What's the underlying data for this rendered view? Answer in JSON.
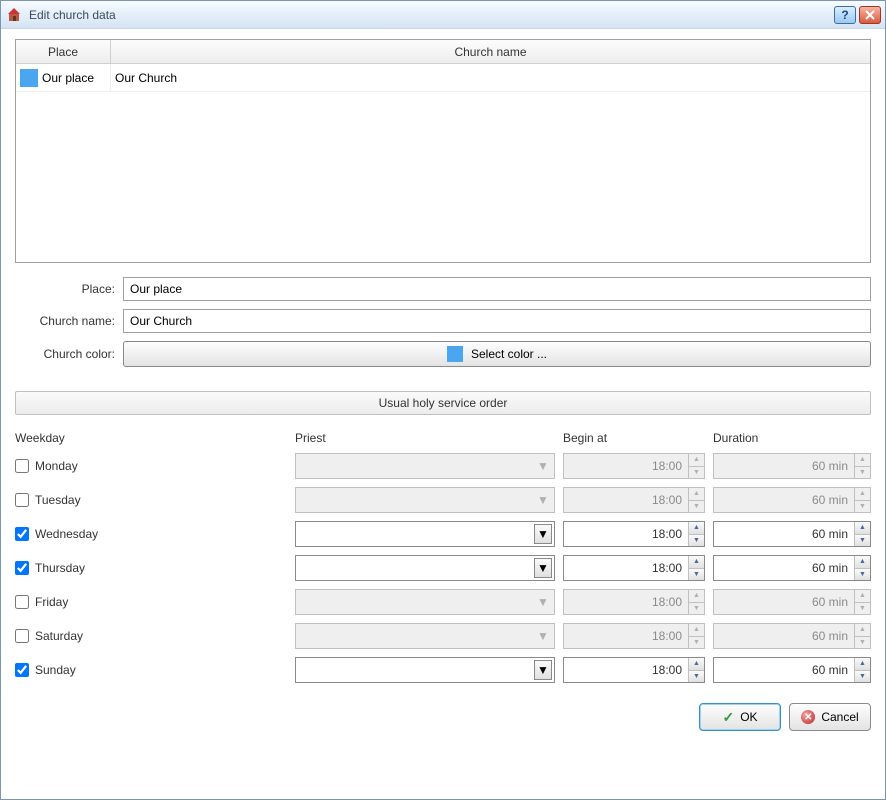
{
  "window": {
    "title": "Edit church data"
  },
  "grid": {
    "headers": {
      "place": "Place",
      "name": "Church name"
    },
    "rows": [
      {
        "color": "#4aa6f0",
        "place": "Our place",
        "name": "Our Church"
      }
    ]
  },
  "form": {
    "labels": {
      "place": "Place:",
      "name": "Church name:",
      "color": "Church color:"
    },
    "values": {
      "place": "Our place",
      "name": "Our Church"
    },
    "color_button": {
      "swatch": "#4aa6f0",
      "label": "Select color ..."
    }
  },
  "section": {
    "title": "Usual holy service order"
  },
  "schedule": {
    "headers": {
      "weekday": "Weekday",
      "priest": "Priest",
      "begin": "Begin at",
      "duration": "Duration"
    },
    "rows": [
      {
        "day": "Monday",
        "checked": false,
        "begin": "18:00",
        "duration": "60 min"
      },
      {
        "day": "Tuesday",
        "checked": false,
        "begin": "18:00",
        "duration": "60 min"
      },
      {
        "day": "Wednesday",
        "checked": true,
        "begin": "18:00",
        "duration": "60 min"
      },
      {
        "day": "Thursday",
        "checked": true,
        "begin": "18:00",
        "duration": "60 min"
      },
      {
        "day": "Friday",
        "checked": false,
        "begin": "18:00",
        "duration": "60 min"
      },
      {
        "day": "Saturday",
        "checked": false,
        "begin": "18:00",
        "duration": "60 min"
      },
      {
        "day": "Sunday",
        "checked": true,
        "begin": "18:00",
        "duration": "60 min"
      }
    ]
  },
  "buttons": {
    "ok": "OK",
    "cancel": "Cancel"
  }
}
